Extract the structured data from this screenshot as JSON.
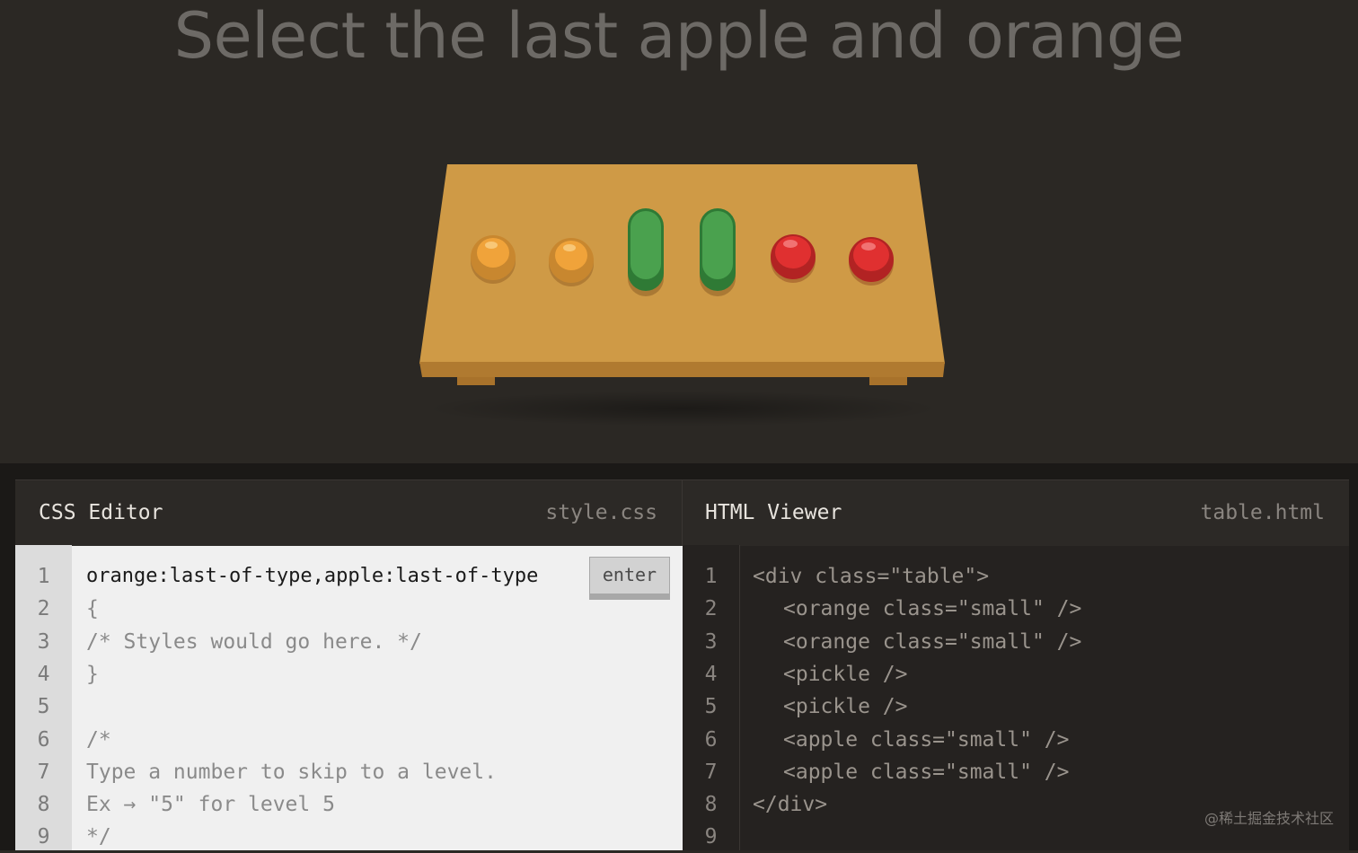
{
  "level_title": "Select the last apple and orange",
  "table_items": [
    {
      "type": "orange",
      "class": "small",
      "icon": "orange-icon"
    },
    {
      "type": "orange",
      "class": "small",
      "icon": "orange-icon"
    },
    {
      "type": "pickle",
      "icon": "pickle-icon"
    },
    {
      "type": "pickle",
      "icon": "pickle-icon"
    },
    {
      "type": "apple",
      "class": "small",
      "icon": "apple-icon"
    },
    {
      "type": "apple",
      "class": "small",
      "icon": "apple-icon"
    }
  ],
  "css_editor": {
    "title": "CSS Editor",
    "filename": "style.css",
    "input_value": "orange:last-of-type,apple:last-of-type",
    "enter_label": "enter",
    "line_numbers": [
      "1",
      "2",
      "3",
      "4",
      "5",
      "6",
      "7",
      "8",
      "9"
    ],
    "lines": [
      "{",
      "/* Styles would go here. */",
      "}",
      "",
      "/*",
      "Type a number to skip to a level.",
      "Ex → \"5\" for level 5",
      "*/"
    ]
  },
  "html_viewer": {
    "title": "HTML Viewer",
    "filename": "table.html",
    "line_numbers": [
      "1",
      "2",
      "3",
      "4",
      "5",
      "6",
      "7",
      "8",
      "9"
    ],
    "lines": [
      "<div class=\"table\">",
      "<orange class=\"small\" />",
      "<orange class=\"small\" />",
      "<pickle />",
      "<pickle />",
      "<apple class=\"small\" />",
      "<apple class=\"small\" />",
      "</div>"
    ]
  },
  "watermark": "@稀土掘金技术社区",
  "colors": {
    "background": "#2b2824",
    "table": "#cf9a46",
    "orange": "#f0a33a",
    "pickle": "#4aa14e",
    "apple": "#e03030"
  }
}
